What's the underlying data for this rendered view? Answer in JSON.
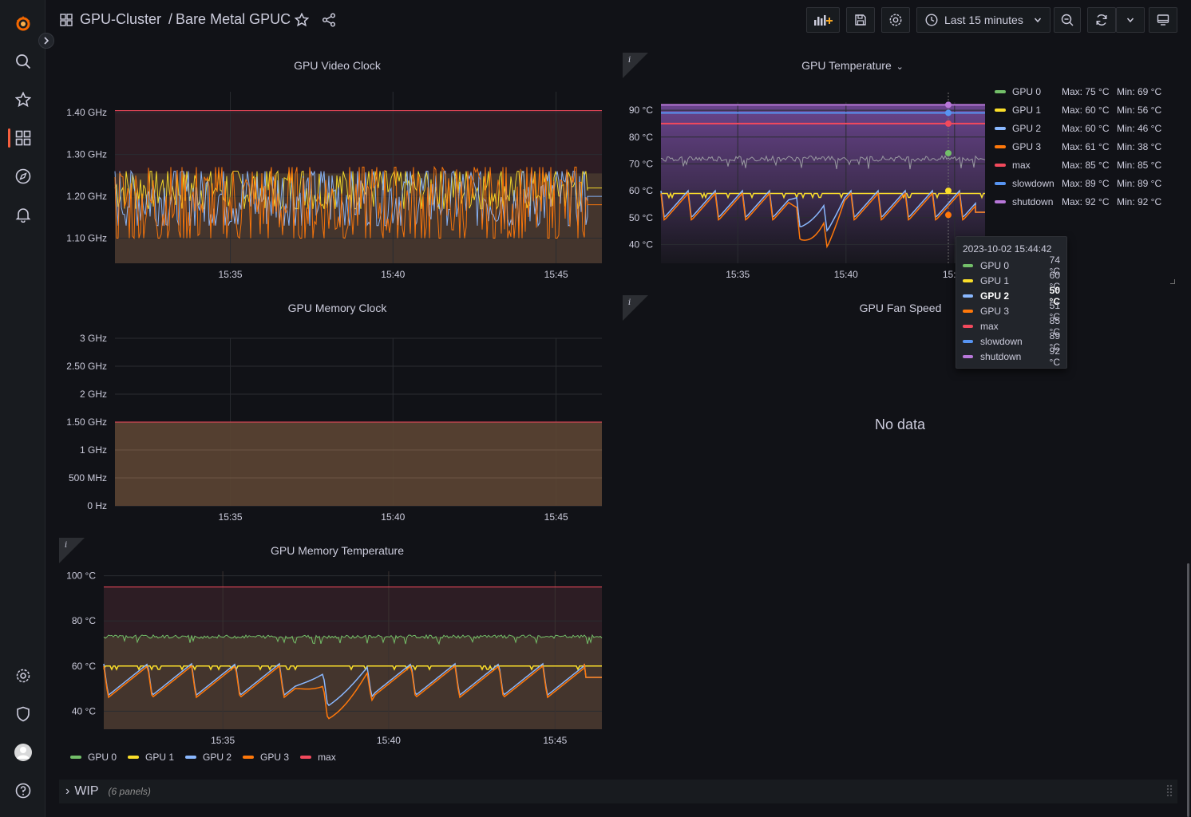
{
  "header": {
    "folder": "GPU-Cluster",
    "separator": "/",
    "dashboard": "Bare Metal GPUC",
    "time_range": "Last 15 minutes"
  },
  "sidebar": {
    "items": [
      "grafana-logo-icon",
      "search-icon",
      "starred-icon",
      "dashboards-icon",
      "explore-icon",
      "alerting-icon",
      "configuration-icon",
      "server-admin-icon",
      "profile-icon",
      "help-icon"
    ]
  },
  "panels": {
    "video_clock": {
      "title": "GPU Video Clock"
    },
    "temperature": {
      "title": "GPU Temperature",
      "title_chevron": "⌄"
    },
    "memory_clock": {
      "title": "GPU Memory Clock"
    },
    "fan_speed": {
      "title": "GPU Fan Speed",
      "no_data": "No data"
    },
    "memory_temperature": {
      "title": "GPU Memory Temperature"
    }
  },
  "temperature_legend": [
    {
      "name": "GPU 0",
      "max": "Max: 75 °C",
      "min": "Min: 69 °C",
      "color": "#73bf69"
    },
    {
      "name": "GPU 1",
      "max": "Max: 60 °C",
      "min": "Min: 56 °C",
      "color": "#fade2a"
    },
    {
      "name": "GPU 2",
      "max": "Max: 60 °C",
      "min": "Min: 46 °C",
      "color": "#8ab8ff"
    },
    {
      "name": "GPU 3",
      "max": "Max: 61 °C",
      "min": "Min: 38 °C",
      "color": "#ff780a"
    },
    {
      "name": "max",
      "max": "Max: 85 °C",
      "min": "Min: 85 °C",
      "color": "#f2495c"
    },
    {
      "name": "slowdown",
      "max": "Max: 89 °C",
      "min": "Min: 89 °C",
      "color": "#5794f2"
    },
    {
      "name": "shutdown",
      "max": "Max: 92 °C",
      "min": "Min: 92 °C",
      "color": "#b877d9"
    }
  ],
  "tooltip": {
    "time": "2023-10-02 15:44:42",
    "rows": [
      {
        "name": "GPU 0",
        "value": "74 °C",
        "color": "#73bf69"
      },
      {
        "name": "GPU 1",
        "value": "60 °C",
        "color": "#fade2a"
      },
      {
        "name": "GPU 2",
        "value": "50 °C",
        "color": "#8ab8ff"
      },
      {
        "name": "GPU 3",
        "value": "51 °C",
        "color": "#ff780a"
      },
      {
        "name": "max",
        "value": "85 °C",
        "color": "#f2495c"
      },
      {
        "name": "slowdown",
        "value": "89 °C",
        "color": "#5794f2"
      },
      {
        "name": "shutdown",
        "value": "92 °C",
        "color": "#b877d9"
      }
    ]
  },
  "memory_temp_legend": [
    {
      "name": "GPU 0",
      "color": "#73bf69"
    },
    {
      "name": "GPU 1",
      "color": "#fade2a"
    },
    {
      "name": "GPU 2",
      "color": "#8ab8ff"
    },
    {
      "name": "GPU 3",
      "color": "#ff780a"
    },
    {
      "name": "max",
      "color": "#f2495c"
    }
  ],
  "row": {
    "chevron": "›",
    "title": "WIP",
    "count": "(6 panels)"
  },
  "chart_data": [
    {
      "type": "line",
      "title": "GPU Video Clock",
      "y_ticks": [
        "1.40 GHz",
        "1.30 GHz",
        "1.20 GHz",
        "1.10 GHz"
      ],
      "x_ticks": [
        "15:35",
        "15:40",
        "15:45"
      ],
      "ylim": [
        1.04,
        1.45
      ],
      "threshold": 1.405,
      "series": [
        {
          "color": "#fade2a",
          "mean": 1.22,
          "low": 1.17,
          "high": 1.26
        },
        {
          "color": "#8ab8ff",
          "mean": 1.2,
          "low": 1.13,
          "high": 1.26
        },
        {
          "color": "#ff780a",
          "mean": 1.18,
          "low": 1.1,
          "high": 1.27
        }
      ]
    },
    {
      "type": "line",
      "title": "GPU Temperature",
      "y_ticks": [
        "90 °C",
        "80 °C",
        "70 °C",
        "60 °C",
        "50 °C",
        "40 °C"
      ],
      "x_ticks": [
        "15:35",
        "15:40",
        "15:45"
      ],
      "ylim": [
        33,
        93
      ],
      "series": [
        {
          "name": "GPU 0",
          "color": "#73bf69",
          "level": 72
        },
        {
          "name": "GPU 1",
          "color": "#fade2a",
          "level": 59
        },
        {
          "name": "GPU 2",
          "color": "#8ab8ff",
          "level": 55
        },
        {
          "name": "GPU 3",
          "color": "#ff780a",
          "level": 52
        },
        {
          "name": "max",
          "color": "#f2495c",
          "level": 85
        },
        {
          "name": "slowdown",
          "color": "#5794f2",
          "level": 89
        },
        {
          "name": "shutdown",
          "color": "#b877d9",
          "level": 92
        }
      ]
    },
    {
      "type": "area",
      "title": "GPU Memory Clock",
      "y_ticks": [
        "3 GHz",
        "2.50 GHz",
        "2 GHz",
        "1.50 GHz",
        "1 GHz",
        "500 MHz",
        "0 Hz"
      ],
      "x_ticks": [
        "15:35",
        "15:40",
        "15:45"
      ],
      "ylim": [
        0,
        3
      ],
      "series": [
        {
          "color": "#ff780a",
          "value": 1.5
        }
      ]
    },
    {
      "type": "line",
      "title": "GPU Memory Temperature",
      "y_ticks": [
        "100 °C",
        "80 °C",
        "60 °C",
        "40 °C"
      ],
      "x_ticks": [
        "15:35",
        "15:40",
        "15:45"
      ],
      "ylim": [
        32,
        102
      ],
      "threshold": 95,
      "series": [
        {
          "name": "GPU 0",
          "color": "#73bf69",
          "level": 73
        },
        {
          "name": "GPU 1",
          "color": "#fade2a",
          "level": 60
        },
        {
          "name": "GPU 2",
          "color": "#8ab8ff",
          "level": 55
        },
        {
          "name": "GPU 3",
          "color": "#ff780a",
          "level": 53
        }
      ]
    }
  ]
}
